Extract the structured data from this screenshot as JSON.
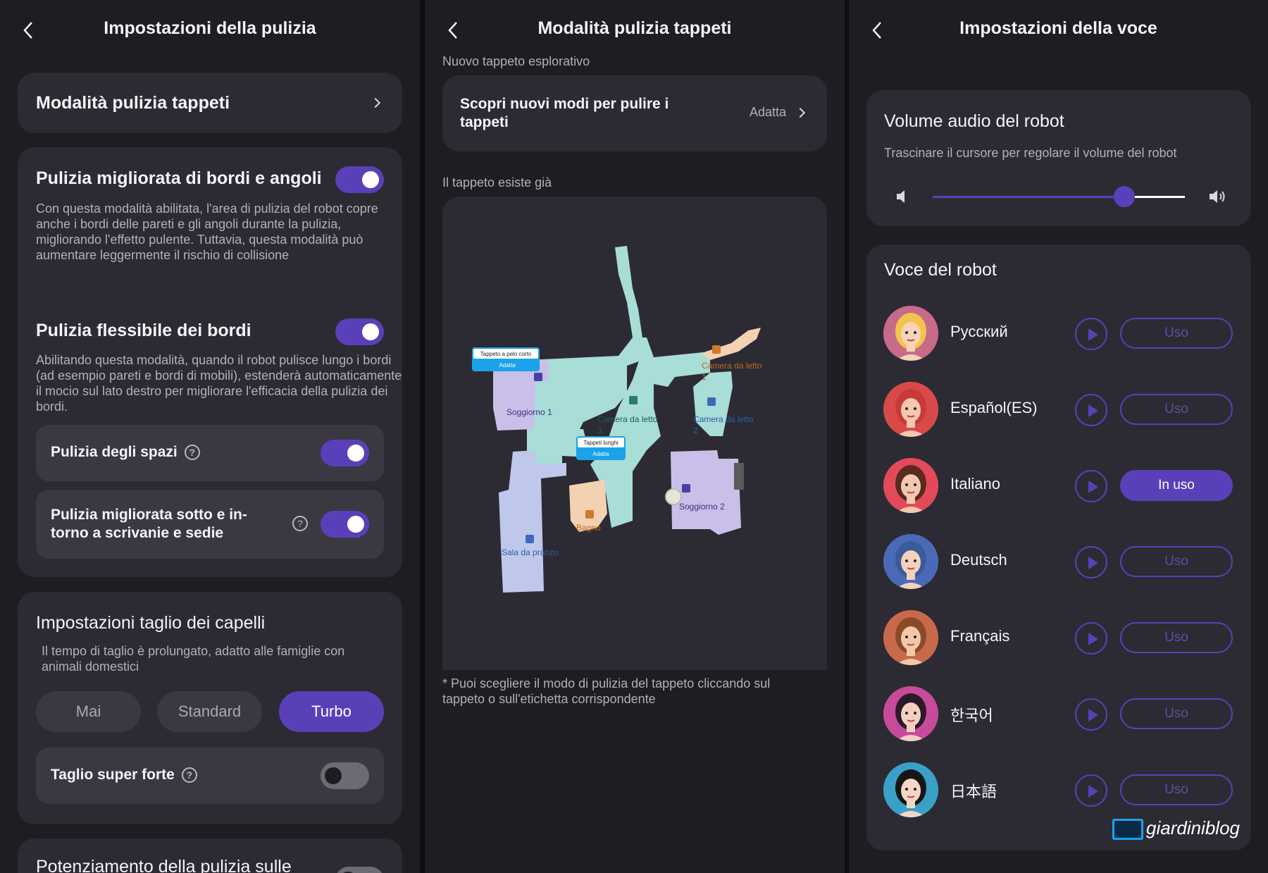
{
  "panel1": {
    "title": "Impostazioni della pulizia",
    "carpet_mode_label": "Modalità pulizia tappeti",
    "edge_title": "Pulizia migliorata di bordi e angoli",
    "edge_desc": "Con questa modalità abilitata, l'area di pulizia del robot copre anche i bordi delle pareti e gli angoli durante la pulizia, migliorando l'effetto pulente. Tuttavia, questa modalità può aumentare leggermente il rischio di collisione",
    "flex_title": "Pulizia flessibile dei bordi",
    "flex_desc": "Abilitando questa modalità, quando il robot pulisce lungo i bordi (ad esempio pareti e bordi di mobili), estenderà automaticamente il mocio sul lato destro per migliorare l'efficacia della pulizia dei bordi.",
    "gaps_label": "Pulizia degli spazi",
    "under_desk_label": "Pulizia migliorata sotto e in-torno a scrivanie e sedie",
    "hair_title": "Impostazioni taglio dei capelli",
    "hair_desc": "Il tempo di taglio è prolungato, adatto alle famiglie con animali domestici",
    "hair_options": [
      "Mai",
      "Standard",
      "Turbo"
    ],
    "hair_selected": "Turbo",
    "super_cut_label": "Taglio super forte",
    "boost_label": "Potenziamento della pulizia sulle",
    "toggles": {
      "edge": true,
      "flex": true,
      "gaps": true,
      "under_desk": true,
      "super_cut": false
    }
  },
  "panel2": {
    "title": "Modalità pulizia tappeti",
    "section1": "Nuovo tappeto esplorativo",
    "discover_label": "Scopri nuovi modi per pulire i tappeti",
    "discover_value": "Adatta",
    "section2": "Il tappeto esiste già",
    "map_labels": {
      "carpet_short": "Tappeto a pelo corto",
      "carpet_short_mode": "Adatta",
      "carpet_long": "Tappeti lunghi",
      "carpet_long_mode": "Adatta",
      "soggiorno": "Soggiorno",
      "soggiorno_num": "1",
      "camera3": "Camera da letto",
      "camera3_num": "3",
      "camera2": "Camera da letto",
      "camera2_num": "2",
      "camera1": "Camera da letto",
      "camera1_num": "1",
      "soggiorno2": "Soggiorno 2",
      "bagno": "Bagno",
      "sala": "Sala da pranzo"
    },
    "footnote": "* Puoi scegliere il modo di pulizia del tappeto cliccando sul tappeto o sull'etichetta corrispondente"
  },
  "panel3": {
    "title": "Impostazioni della voce",
    "volume_title": "Volume audio del robot",
    "volume_desc": "Trascinare il cursore per regolare il volume del robot",
    "volume_level": 0.76,
    "voice_title": "Voce del robot",
    "use_label": "Uso",
    "in_use_label": "In uso",
    "languages": [
      "Русский",
      "Español(ES)",
      "Italiano",
      "Deutsch",
      "Français",
      "한국어",
      "日本語"
    ],
    "selected_language": "Italiano",
    "watermark": "giardiniblog"
  },
  "colors": {
    "accent": "#5a40b8",
    "background": "#1e1d22",
    "card": "#2c2b33"
  }
}
